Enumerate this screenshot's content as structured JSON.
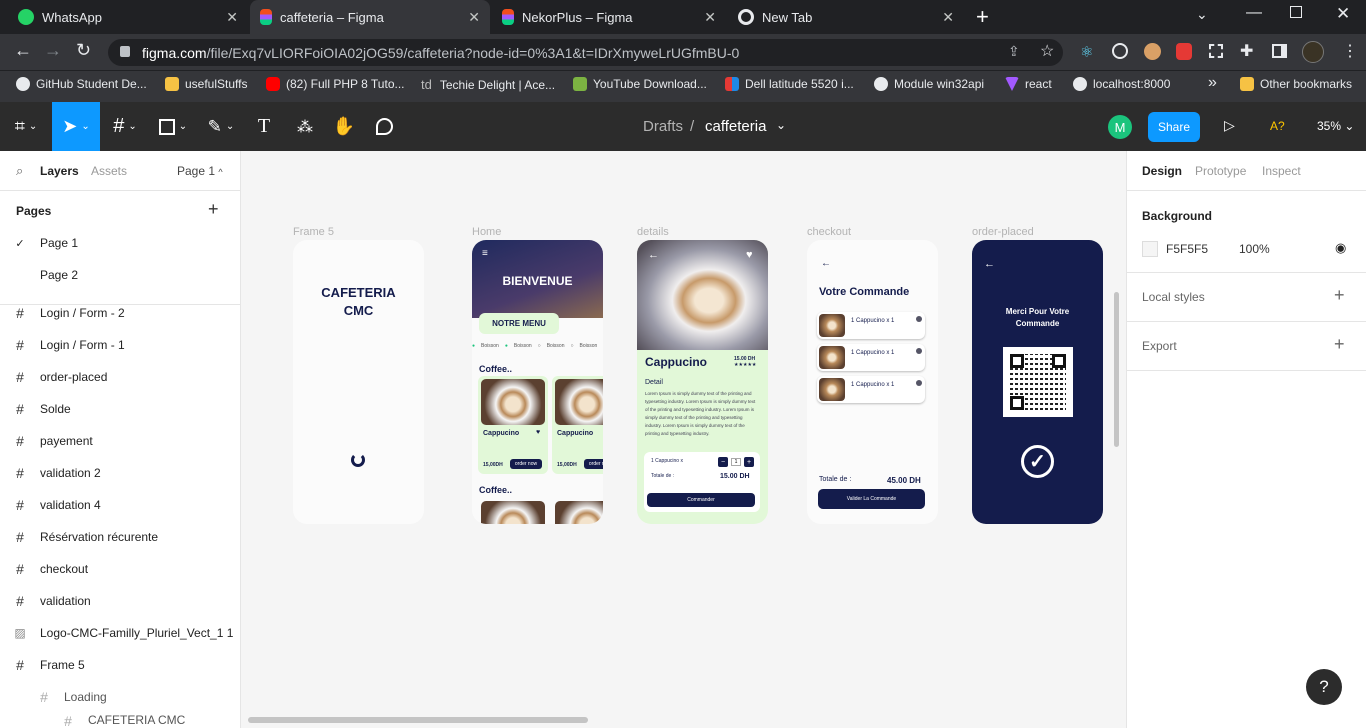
{
  "browser": {
    "tabs": [
      {
        "title": "WhatsApp"
      },
      {
        "title": "caffeteria – Figma"
      },
      {
        "title": "NekorPlus – Figma"
      },
      {
        "title": "New Tab"
      }
    ],
    "url_host": "figma.com",
    "url_path": "/file/Exq7vLIORFoiOIA02jOG59/caffeteria?node-id=0%3A1&t=IDrXmyweLrUGfmBU-0",
    "bookmarks": [
      {
        "label": "GitHub Student De..."
      },
      {
        "label": "usefulStuffs"
      },
      {
        "label": "(82) Full PHP 8 Tuto..."
      },
      {
        "label": "Techie Delight | Ace..."
      },
      {
        "label": "YouTube Download..."
      },
      {
        "label": "Dell latitude 5520 i..."
      },
      {
        "label": "Module win32api"
      },
      {
        "label": "react"
      },
      {
        "label": "localhost:8000"
      }
    ],
    "other_bookmarks": "Other bookmarks",
    "more": "»",
    "td": "td"
  },
  "figma": {
    "breadcrumb_parent": "Drafts",
    "breadcrumb_sep": "/",
    "file_name": "caffeteria",
    "avatar": "M",
    "share": "Share",
    "a11y": "A?",
    "zoom": "35%"
  },
  "left_panel": {
    "tab_layers": "Layers",
    "tab_assets": "Assets",
    "page_selector": "Page 1",
    "pages_heading": "Pages",
    "pages": [
      {
        "label": "Page 1"
      },
      {
        "label": "Page 2"
      }
    ],
    "layers": [
      {
        "label": "Login / Form - 2"
      },
      {
        "label": "Login / Form - 1"
      },
      {
        "label": "order-placed"
      },
      {
        "label": "Solde"
      },
      {
        "label": "payement"
      },
      {
        "label": "validation 2"
      },
      {
        "label": "validation 4"
      },
      {
        "label": "Résérvation récurente"
      },
      {
        "label": "checkout"
      },
      {
        "label": "validation"
      },
      {
        "label": "Logo-CMC-Familly_Pluriel_Vect_1 1"
      },
      {
        "label": "Frame 5"
      },
      {
        "label": "Loading"
      },
      {
        "label": "CAFETERIA CMC"
      }
    ]
  },
  "right_panel": {
    "tabs": [
      "Design",
      "Prototype",
      "Inspect"
    ],
    "background_heading": "Background",
    "bg_hex": "F5F5F5",
    "bg_opacity": "100%",
    "local_styles": "Local styles",
    "export": "Export",
    "help": "?"
  },
  "canvas": {
    "frame_labels": [
      "Frame 5",
      "Home",
      "details",
      "checkout",
      "order-placed"
    ],
    "splash_title": "CAFETERIA\nCMC",
    "home": {
      "welcome": "BIENVENUE",
      "menu_btn": "NOTRE MENU",
      "filters": [
        "Boisson",
        "Boisson",
        "Boisson",
        "Boisson"
      ],
      "section": "Coffee..",
      "section2": "Coffee..",
      "card_name": "Cappucino",
      "card_price": "15,00DH",
      "card_btn": "order now"
    },
    "details": {
      "title": "Cappucino",
      "price": "15.00 DH",
      "detail_heading": "Detail",
      "lorem": "Lorem Ipsum is simply dummy text of the printing and typesetting industry. Lorem Ipsum is simply dummy text of the printing and typesetting industry. Lorem Ipsum is simply dummy text of the printing and typesetting industry. Lorem Ipsum is simply dummy text of the printing and typesetting industry.",
      "line_item": "1 Cappucino x",
      "qty": "1",
      "total_label": "Totale de :",
      "total": "15.00 DH",
      "order_btn": "Commander"
    },
    "checkout": {
      "title": "Votre Commande",
      "items": [
        "1 Cappucino x 1",
        "1 Cappucino x 1",
        "1 Cappucino x 1"
      ],
      "total_label": "Totale de :",
      "total": "45.00 DH",
      "btn": "Valider La Commande"
    },
    "order_placed": {
      "message": "Merci Pour Votre Commande"
    }
  },
  "colors": {
    "navy": "#141c4c",
    "mint": "#e2f8d8",
    "figma_blue": "#0d99ff"
  }
}
